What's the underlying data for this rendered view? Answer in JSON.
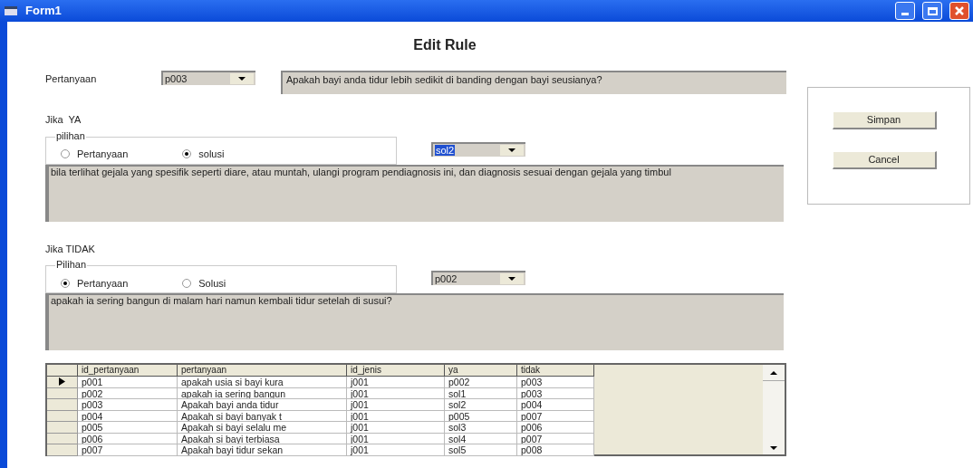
{
  "window": {
    "title": "Form1"
  },
  "heading": "Edit Rule",
  "question": {
    "label": "Pertanyaan",
    "combo": "p003",
    "text": "Apakah bayi anda tidur lebih sedikit di banding dengan bayi seusianya?"
  },
  "yes": {
    "label": "Jika  YA",
    "group": "pilihan",
    "options": [
      {
        "label": "Pertanyaan",
        "selected": false
      },
      {
        "label": "solusi",
        "selected": true
      }
    ],
    "combo": "sol2",
    "combo_highlighted": true,
    "text": "bila terlihat gejala yang spesifik seperti diare, atau muntah, ulangi program pendiagnosis ini, dan diagnosis sesuai dengan gejala yang timbul"
  },
  "no": {
    "label": "Jika TIDAK",
    "group": "Pilihan",
    "options": [
      {
        "label": "Pertanyaan",
        "selected": true
      },
      {
        "label": "Solusi",
        "selected": false
      }
    ],
    "combo": "p002",
    "combo_highlighted": false,
    "text": "apakah ia sering bangun di malam hari namun kembali tidur setelah di susui?"
  },
  "buttons": [
    "Simpan",
    "Cancel"
  ],
  "table": {
    "columns": [
      "id_pertanyaan",
      "pertanyaan",
      "id_jenis",
      "ya",
      "tidak"
    ],
    "rows": [
      {
        "cells": [
          "p001",
          "apakah usia si bayi kura",
          "j001",
          "p002",
          "p003"
        ],
        "current": true
      },
      {
        "cells": [
          "p002",
          "apakah ia sering bangun",
          "j001",
          "sol1",
          "p003"
        ],
        "current": false
      },
      {
        "cells": [
          "p003",
          "Apakah bayi anda tidur",
          "j001",
          "sol2",
          "p004"
        ],
        "current": false
      },
      {
        "cells": [
          "p004",
          "Apakah si bayi banyak t",
          "j001",
          "p005",
          "p007"
        ],
        "current": false
      },
      {
        "cells": [
          "p005",
          "Apakah si bayi selalu me",
          "j001",
          "sol3",
          "p006"
        ],
        "current": false
      },
      {
        "cells": [
          "p006",
          "Apakah si bayi terbiasa",
          "j001",
          "sol4",
          "p007"
        ],
        "current": false
      },
      {
        "cells": [
          "p007",
          "Apakah bayi tidur sekan",
          "j001",
          "sol5",
          "p008"
        ],
        "current": false
      }
    ]
  }
}
